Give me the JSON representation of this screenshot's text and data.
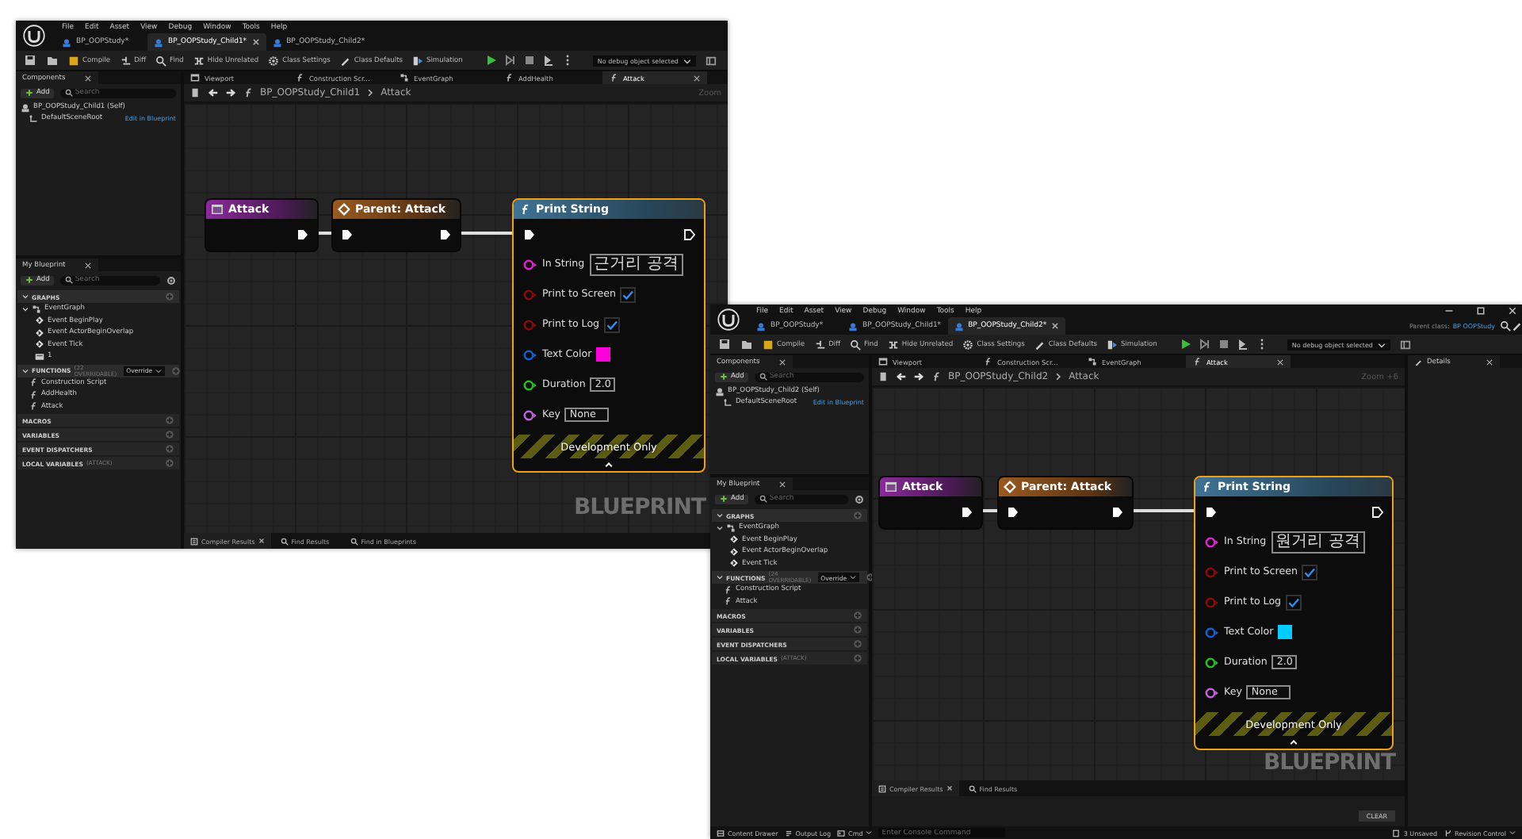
{
  "windows": [
    {
      "menu": [
        "File",
        "Edit",
        "Asset",
        "View",
        "Debug",
        "Window",
        "Tools",
        "Help"
      ],
      "doc_tabs": [
        {
          "label": "BP_OOPStudy*",
          "selected": false
        },
        {
          "label": "BP_OOPStudy_Child1*",
          "selected": true
        },
        {
          "label": "BP_OOPStudy_Child2*",
          "selected": false
        }
      ],
      "toolbar": [
        {
          "kind": "compile",
          "label": "Compile"
        },
        {
          "kind": "diff",
          "label": "Diff"
        },
        {
          "kind": "find",
          "label": "Find"
        },
        {
          "kind": "hide",
          "label": "Hide Unrelated"
        },
        {
          "kind": "settings",
          "label": "Class Settings"
        },
        {
          "kind": "defaults",
          "label": "Class Defaults"
        },
        {
          "kind": "simulation",
          "label": "Simulation"
        }
      ],
      "debug_object": "No debug object selected",
      "components": {
        "tab": "Components",
        "add": "Add",
        "search": {
          "placeholder": "Search"
        },
        "root": "BP_OOPStudy_Child1 (Self)",
        "scene_root": "DefaultSceneRoot",
        "edit_link": "Edit in Blueprint"
      },
      "my_blueprint": {
        "tab": "My Blueprint",
        "add": "Add",
        "search": {
          "placeholder": "Search"
        },
        "sections": [
          {
            "title": "GRAPHS",
            "expanded": true,
            "items": [
              {
                "kind": "graph",
                "label": "EventGraph",
                "children": [
                  {
                    "kind": "event",
                    "label": "Event BeginPlay"
                  },
                  {
                    "kind": "event",
                    "label": "Event ActorBeginOverlap"
                  },
                  {
                    "kind": "event",
                    "label": "Event Tick"
                  },
                  {
                    "kind": "comment",
                    "label": "1"
                  }
                ]
              }
            ]
          },
          {
            "title": "FUNCTIONS",
            "note": "(22 OVERRIDABLE)",
            "dropdown": "Override",
            "expanded": true,
            "items": [
              {
                "kind": "function",
                "label": "Construction Script"
              },
              {
                "kind": "function",
                "label": "AddHealth"
              },
              {
                "kind": "function",
                "label": "Attack"
              }
            ]
          },
          {
            "title": "MACROS",
            "expanded": false
          },
          {
            "title": "VARIABLES",
            "expanded": false
          },
          {
            "title": "EVENT DISPATCHERS",
            "expanded": false
          },
          {
            "title": "LOCAL VARIABLES",
            "note": "(ATTACK)",
            "expanded": false
          }
        ]
      },
      "graph_tabs": [
        {
          "kind": "viewport",
          "label": "Viewport",
          "selected": false
        },
        {
          "kind": "function",
          "label": "Construction Scr...",
          "selected": false
        },
        {
          "kind": "event_graph",
          "label": "EventGraph",
          "selected": false
        },
        {
          "kind": "function",
          "label": "AddHealth",
          "selected": false
        },
        {
          "kind": "function",
          "label": "Attack",
          "selected": true
        }
      ],
      "breadcrumb": {
        "path": "BP_OOPStudy_Child1",
        "current": "Attack"
      },
      "zoom": "Zoom",
      "nodes": [
        {
          "kind": "entry",
          "title": "Attack",
          "selected": false
        },
        {
          "kind": "parent",
          "title": "Parent: Attack",
          "selected": false
        },
        {
          "kind": "call",
          "title": "Print String",
          "selected": true,
          "footer": "Development Only",
          "pins": [
            {
              "kind": "text",
              "label": "In String",
              "color": "#e020d0",
              "value": "근거리 공격"
            },
            {
              "kind": "bool",
              "label": "Print to Screen",
              "color": "#8a0a0a",
              "checked": true
            },
            {
              "kind": "bool",
              "label": "Print to Log",
              "color": "#8a0a0a",
              "checked": true
            },
            {
              "kind": "color",
              "label": "Text Color",
              "color": "#1060d0",
              "value": {
                "color": "#ff00dd"
              }
            },
            {
              "kind": "number",
              "label": "Duration",
              "color": "#20c020",
              "value": "2.0"
            },
            {
              "kind": "name",
              "label": "Key",
              "color": "#c060e0",
              "value": "None"
            }
          ]
        }
      ],
      "watermark": "BLUEPRINT",
      "bottom_tabs": [
        {
          "kind": "results",
          "label": "Compiler Results",
          "selected": true
        },
        {
          "kind": "find",
          "label": "Find Results",
          "selected": false
        },
        {
          "kind": "find",
          "label": "Find in Blueprints",
          "selected": false
        }
      ]
    },
    {
      "menu": [
        "File",
        "Edit",
        "Asset",
        "View",
        "Debug",
        "Window",
        "Tools",
        "Help"
      ],
      "window_controls": [
        {
          "kind": "minimize"
        },
        {
          "kind": "maximize"
        },
        {
          "kind": "close"
        }
      ],
      "doc_tabs": [
        {
          "label": "BP_OOPStudy*",
          "selected": false
        },
        {
          "label": "BP_OOPStudy_Child1*",
          "selected": false
        },
        {
          "label": "BP_OOPStudy_Child2*",
          "selected": true
        }
      ],
      "parent_class": {
        "label": "Parent class:",
        "value": "BP OOPStudy"
      },
      "toolbar": [
        {
          "kind": "compile",
          "label": "Compile"
        },
        {
          "kind": "diff",
          "label": "Diff"
        },
        {
          "kind": "find",
          "label": "Find"
        },
        {
          "kind": "hide",
          "label": "Hide Unrelated"
        },
        {
          "kind": "settings",
          "label": "Class Settings"
        },
        {
          "kind": "defaults",
          "label": "Class Defaults"
        },
        {
          "kind": "simulation",
          "label": "Simulation"
        }
      ],
      "debug_object": "No debug object selected",
      "components": {
        "tab": "Components",
        "add": "Add",
        "search": {
          "placeholder": "Search"
        },
        "root": "BP_OOPStudy_Child2 (Self)",
        "scene_root": "DefaultSceneRoot",
        "edit_link": "Edit in Blueprint"
      },
      "my_blueprint": {
        "tab": "My Blueprint",
        "add": "Add",
        "search": {
          "placeholder": "Search"
        },
        "sections": [
          {
            "title": "GRAPHS",
            "expanded": true,
            "items": [
              {
                "kind": "graph",
                "label": "EventGraph",
                "children": [
                  {
                    "kind": "event",
                    "label": "Event BeginPlay"
                  },
                  {
                    "kind": "event",
                    "label": "Event ActorBeginOverlap"
                  },
                  {
                    "kind": "event",
                    "label": "Event Tick"
                  }
                ]
              }
            ]
          },
          {
            "title": "FUNCTIONS",
            "note": "(24 OVERRIDABLE)",
            "dropdown": "Override",
            "expanded": true,
            "items": [
              {
                "kind": "function",
                "label": "Construction Script"
              },
              {
                "kind": "function",
                "label": "Attack"
              }
            ]
          },
          {
            "title": "MACROS",
            "expanded": false
          },
          {
            "title": "VARIABLES",
            "expanded": false
          },
          {
            "title": "EVENT DISPATCHERS",
            "expanded": false
          },
          {
            "title": "LOCAL VARIABLES",
            "note": "(ATTACK)",
            "expanded": false
          }
        ]
      },
      "graph_tabs": [
        {
          "kind": "viewport",
          "label": "Viewport",
          "selected": false
        },
        {
          "kind": "function",
          "label": "Construction Scr...",
          "selected": false
        },
        {
          "kind": "event_graph",
          "label": "EventGraph",
          "selected": false
        },
        {
          "kind": "function",
          "label": "Attack",
          "selected": true
        }
      ],
      "breadcrumb": {
        "path": "BP_OOPStudy_Child2",
        "current": "Attack"
      },
      "zoom": "Zoom +6",
      "nodes": [
        {
          "kind": "entry",
          "title": "Attack",
          "selected": false
        },
        {
          "kind": "parent",
          "title": "Parent: Attack",
          "selected": false
        },
        {
          "kind": "call",
          "title": "Print String",
          "selected": true,
          "footer": "Development Only",
          "pins": [
            {
              "kind": "text",
              "label": "In String",
              "color": "#e020d0",
              "value": "원거리 공격"
            },
            {
              "kind": "bool",
              "label": "Print to Screen",
              "color": "#8a0a0a",
              "checked": true
            },
            {
              "kind": "bool",
              "label": "Print to Log",
              "color": "#8a0a0a",
              "checked": true
            },
            {
              "kind": "color",
              "label": "Text Color",
              "color": "#1060d0",
              "value": {
                "color": "#00ccff"
              }
            },
            {
              "kind": "number",
              "label": "Duration",
              "color": "#20c020",
              "value": "2.0"
            },
            {
              "kind": "name",
              "label": "Key",
              "color": "#c060e0",
              "value": "None"
            }
          ]
        }
      ],
      "watermark": "BLUEPRINT",
      "bottom_tabs": [
        {
          "kind": "results",
          "label": "Compiler Results",
          "selected": true
        },
        {
          "kind": "find",
          "label": "Find Results",
          "selected": false
        }
      ],
      "clear_button": "CLEAR",
      "details_tab": "Details",
      "status_bar": {
        "buttons": [
          {
            "kind": "drawer",
            "label": "Content Drawer"
          },
          {
            "kind": "log",
            "label": "Output Log"
          },
          {
            "kind": "cmd",
            "label": "Cmd"
          }
        ],
        "console_placeholder": "Enter Console Command",
        "unsaved": "3 Unsaved",
        "revision": "Revision Control"
      }
    }
  ]
}
